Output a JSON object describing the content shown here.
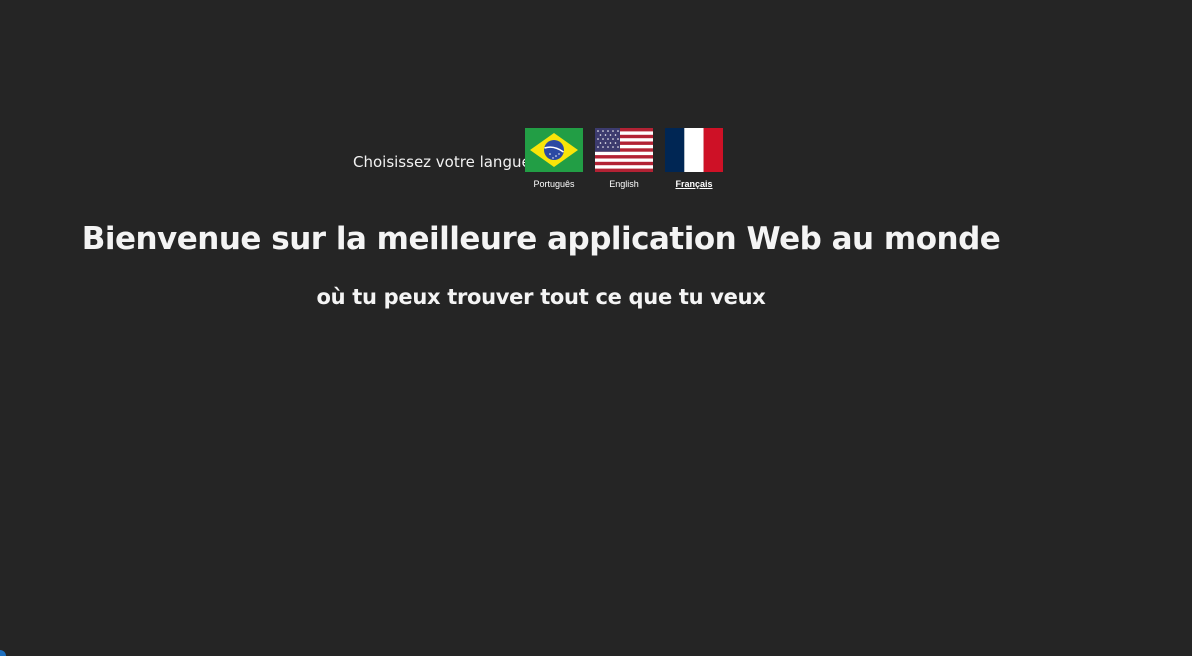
{
  "language_selector": {
    "prompt": "Choisissez votre langue",
    "options": [
      {
        "label": "Português",
        "flag": "brazil-flag-icon",
        "active": false
      },
      {
        "label": "English",
        "flag": "usa-flag-icon",
        "active": false
      },
      {
        "label": "Français",
        "flag": "france-flag-icon",
        "active": true
      }
    ]
  },
  "main": {
    "headline": "Bienvenue sur la meilleure application Web au monde",
    "subline": "où tu peux trouver tout ce que tu veux"
  },
  "colors": {
    "background": "#252525",
    "text": "#ffffff"
  }
}
